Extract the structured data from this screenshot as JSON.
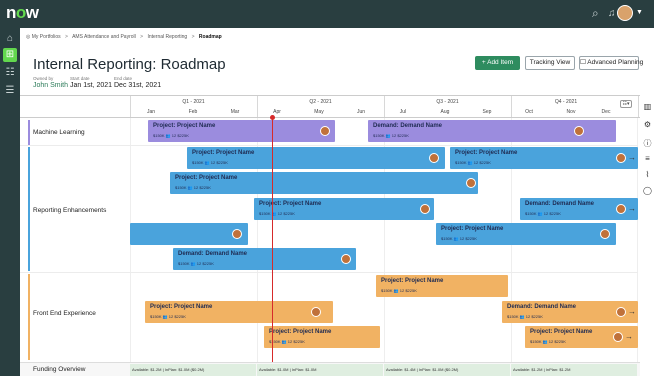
{
  "app": {
    "logo_text": "now",
    "logo_o": "o"
  },
  "topbar": {
    "search_icon": "search-icon",
    "bell_icon": "bell-icon"
  },
  "breadcrumb": {
    "items": [
      {
        "label": "◎ My Portfolios"
      },
      {
        "label": "AMS Attendance and Payroll"
      },
      {
        "label": "Internal Reporting"
      },
      {
        "label": "Roadmap"
      }
    ],
    "sep": ">"
  },
  "page": {
    "title": "Internal Reporting: Roadmap",
    "owner_label": "Owned by",
    "owner": "John Smith",
    "start_label": "Start date",
    "start": "Jan 1st, 2021",
    "end_label": "End date",
    "end": "Dec 31st, 2021"
  },
  "actions": {
    "add_item": "+ Add Item",
    "tracking_view": "Tracking View",
    "advanced_planning": "☐ Advanced Planning"
  },
  "timeline": {
    "quarters": [
      "Q1 - 2021",
      "Q2 - 2021",
      "Q3 - 2021",
      "Q4 - 2021"
    ],
    "months": [
      "Jan",
      "Feb",
      "Mar",
      "Apr",
      "May",
      "Jun",
      "Jul",
      "Aug",
      "Sep",
      "Oct",
      "Nov",
      "Dec"
    ],
    "options_label": "☷▾"
  },
  "groups": [
    {
      "label": "Machine Learning",
      "color": "#9b8cde"
    },
    {
      "label": "Reporting Enhancements",
      "color": "#4aa3dc"
    },
    {
      "label": "Front End Experience",
      "color": "#f1b263"
    }
  ],
  "bars": [
    {
      "title": "Project: Project Name",
      "meta": "$150K  👥 12  $225K"
    },
    {
      "title": "Demand: Demand Name",
      "meta": "$150K  👥 12  $225K"
    },
    {
      "title": "Project: Project Name",
      "meta": "$150K  👥 12  $225K"
    },
    {
      "title": "Project: Project Name",
      "meta": "$150K  👥 12  $225K"
    },
    {
      "title": "Project: Project Name",
      "meta": "$150K  👥 12  $225K"
    },
    {
      "title": "Project: Project Name",
      "meta": "$150K  👥 12  $225K"
    },
    {
      "title": "Demand: Demand Name",
      "meta": "$150K  👥 12  $225K"
    },
    {
      "title": "",
      "meta": ""
    },
    {
      "title": "Project: Project Name",
      "meta": "$150K  👥 12  $225K"
    },
    {
      "title": "Demand: Demand Name",
      "meta": "$150K  👥 12  $225K"
    },
    {
      "title": "Project: Project Name",
      "meta": "$150K  👥 12  $225K"
    },
    {
      "title": "Project: Project Name",
      "meta": "$150K  👥 12  $225K"
    },
    {
      "title": "Demand: Demand Name",
      "meta": "$150K  👥 12  $225K"
    },
    {
      "title": "Project: Project Name",
      "meta": "$150K  👥 12  $225K"
    },
    {
      "title": "Project: Project Name",
      "meta": "$150K  👥 12  $225K"
    }
  ],
  "funding": {
    "label": "Funding Overview",
    "cells": [
      "Available: $1.2M | InPlan: $1.0M ($0.2M)",
      "Available: $1.0M | InPlan: $1.0M",
      "Available: $1.4M | InPlan: $1.0M ($0.2M)",
      "Available: $1.2M | InPlan: $1.2M"
    ]
  },
  "colors": {
    "topbar": "#293e40",
    "accent": "#62d84e",
    "primary_button": "#2e8c5f",
    "today_line": "#d72a2a"
  }
}
